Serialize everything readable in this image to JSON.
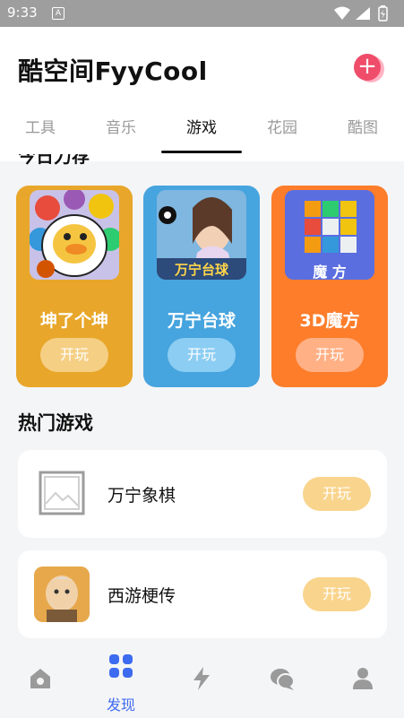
{
  "status": {
    "time": "9:33",
    "sim_label": "A"
  },
  "header": {
    "app_title": "酷空间FyyCool",
    "add_symbol": "+"
  },
  "tabs": [
    {
      "label": "工具",
      "active": false
    },
    {
      "label": "音乐",
      "active": false
    },
    {
      "label": "游戏",
      "active": true
    },
    {
      "label": "花园",
      "active": false
    },
    {
      "label": "酷图",
      "active": false
    }
  ],
  "sections": {
    "cut_title": "今日力荐",
    "hot_title": "热门游戏"
  },
  "featured": [
    {
      "name": "坤了个坤",
      "play": "开玩",
      "bg": "#e8a72b",
      "btn": "#f5cf84",
      "thumb_text": ""
    },
    {
      "name": "万宁台球",
      "play": "开玩",
      "bg": "#46a4de",
      "btn": "#8ccdf3",
      "thumb_text": "万宁台球"
    },
    {
      "name": "3D魔方",
      "play": "开玩",
      "bg": "#fd7d2b",
      "btn": "#ffb085",
      "thumb_text": "魔 方"
    }
  ],
  "hot": [
    {
      "name": "万宁象棋",
      "play": "开玩"
    },
    {
      "name": "西游梗传",
      "play": "开玩"
    }
  ],
  "nav": {
    "active_label": "发现",
    "accent": "#3d6bf0"
  }
}
